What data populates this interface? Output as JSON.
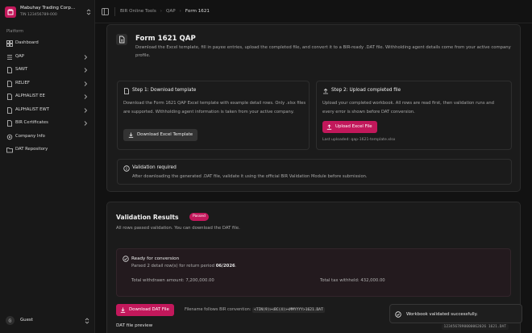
{
  "app": {
    "brand_name": "Mabuhay Trading Corp...",
    "brand_tin": "TIN 123456789-000",
    "accent": "#c2185b"
  },
  "sidebar": {
    "section_label": "Platform",
    "items": [
      {
        "label": "Dashboard",
        "icon": "dashboard-icon",
        "has_chevron": false
      },
      {
        "label": "QAP",
        "icon": "list-icon",
        "has_chevron": true
      },
      {
        "label": "SAWT",
        "icon": "file-icon",
        "has_chevron": true
      },
      {
        "label": "RELIEF",
        "icon": "file-icon",
        "has_chevron": true
      },
      {
        "label": "ALPHALIST EE",
        "icon": "file-icon",
        "has_chevron": true
      },
      {
        "label": "ALPHALIST EWT",
        "icon": "file-icon",
        "has_chevron": true
      },
      {
        "label": "BIR Certificates",
        "icon": "file-icon",
        "has_chevron": true
      },
      {
        "label": "Company Info",
        "icon": "settings-icon",
        "has_chevron": false
      },
      {
        "label": "DAT Repository",
        "icon": "folder-icon",
        "has_chevron": false
      }
    ],
    "user_name": "Guest"
  },
  "breadcrumb": [
    "BIR Online Tools",
    "QAP",
    "Form 1621"
  ],
  "form": {
    "title": "Form 1621 QAP",
    "description": "Download the Excel template, fill in payee entries, upload the completed file, and convert it to a BIR-ready .DAT file. Withholding agent details come from your active company profile.",
    "step1": {
      "title": "Step 1: Download template",
      "text": "Download the Form 1621 QAP Excel template with example detail rows. Only .xlsx files are supported. Withholding agent information is taken from your active company.",
      "button": "Download Excel Template"
    },
    "step2": {
      "title": "Step 2: Upload completed file",
      "text": "Upload your completed workbook. All rows are read first, then validation runs and every error is shown before DAT conversion.",
      "button": "Upload Excel File",
      "last_uploaded": "Last uploaded: qap-1621-template.xlsx"
    },
    "validation_note": {
      "title": "Validation required",
      "text": "After downloading the generated .DAT file, validate it using the official BIR Validation Module before submission."
    }
  },
  "results": {
    "title": "Validation Results",
    "badge": "Passed",
    "subtitle": "All rows passed validation. You can download the DAT file.",
    "ready_title": "Ready for conversion",
    "ready_sub_prefix": "Parsed 2 detail row(s) for return period ",
    "ready_period": "06/2026",
    "ready_sub_suffix": ".",
    "total_withdrawn": "Total withdrawn amount: 7,200,000.00",
    "total_tax": "Total tax withheld: 432,000.00",
    "download_button": "Download DAT File",
    "filename_note": "Filename follows BIR convention:",
    "filename_pattern": "<TIN(9)><BC(4)><MMYYYY>1621.DAT",
    "preview_label": "DAT file preview",
    "preview_filename": "1234567890000062026 1621.DAT"
  },
  "toast": {
    "message": "Workbook validated successfully."
  }
}
